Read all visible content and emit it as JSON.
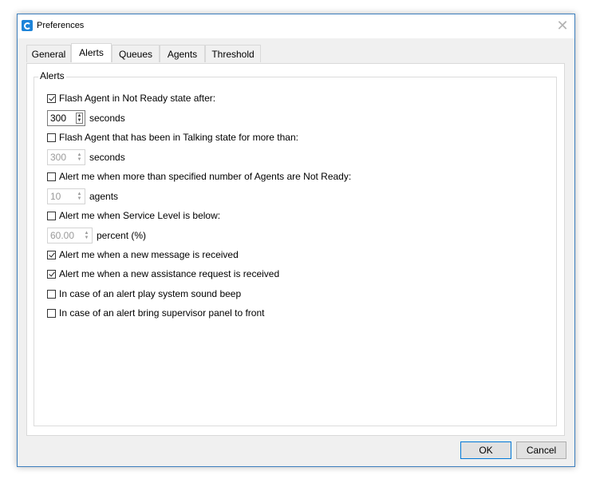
{
  "window": {
    "title": "Preferences",
    "icon": "app-logo-icon",
    "close_glyph": "✕"
  },
  "tabs": [
    {
      "label": "General"
    },
    {
      "label": "Alerts",
      "active": true
    },
    {
      "label": "Queues"
    },
    {
      "label": "Agents"
    },
    {
      "label": "Threshold"
    }
  ],
  "alerts": {
    "group_label": "Alerts",
    "flash_not_ready": {
      "label": "Flash Agent in Not Ready state after:",
      "checked": true,
      "value": "300",
      "unit": "seconds"
    },
    "flash_talking": {
      "label": "Flash Agent that has been in Talking state for more than:",
      "checked": false,
      "value": "300",
      "unit": "seconds"
    },
    "agents_not_ready": {
      "label": "Alert me when more than specified number of Agents are Not Ready:",
      "checked": false,
      "value": "10",
      "unit": "agents"
    },
    "service_level": {
      "label": "Alert me when Service Level is below:",
      "checked": false,
      "value": "60.00",
      "unit": "percent (%)"
    },
    "new_message": {
      "label": "Alert me when a new message is received",
      "checked": true
    },
    "new_assistance": {
      "label": "Alert me when a new assistance request is received",
      "checked": true
    },
    "sound_beep": {
      "label": "In case of an alert play system sound beep",
      "checked": false
    },
    "bring_front": {
      "label": "In case of an alert bring supervisor panel to front",
      "checked": false
    }
  },
  "buttons": {
    "ok": "OK",
    "cancel": "Cancel"
  },
  "colors": {
    "accent": "#0078d7",
    "border_focus": "#3c7ebd"
  }
}
